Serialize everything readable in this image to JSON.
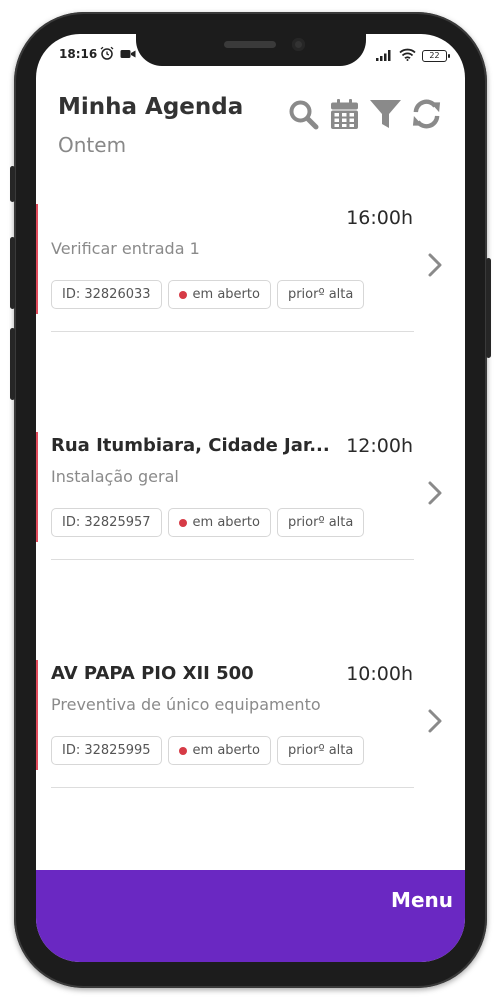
{
  "status": {
    "time": "18:16",
    "battery": "22",
    "icons": [
      "alarm-icon",
      "video-icon",
      "signal-icon",
      "wifi-icon",
      "battery-icon"
    ]
  },
  "header": {
    "title": "Minha Agenda",
    "subtitle": "Ontem",
    "actions": [
      "search-icon",
      "calendar-icon",
      "filter-icon",
      "refresh-icon"
    ]
  },
  "tasks": [
    {
      "address": "",
      "time": "16:00h",
      "description": "Verificar entrada 1",
      "id": "ID: 32826033",
      "status": "em aberto",
      "priority": "priorº alta"
    },
    {
      "address": "Rua Itumbiara, Cidade Jar...",
      "time": "12:00h",
      "description": "Instalação geral",
      "id": "ID: 32825957",
      "status": "em aberto",
      "priority": "priorº alta"
    },
    {
      "address": "AV PAPA PIO XII 500",
      "time": "10:00h",
      "description": "Preventiva de único equipamento",
      "id": "ID: 32825995",
      "status": "em aberto",
      "priority": "priorº alta"
    }
  ],
  "footer": {
    "menu_label": "Menu"
  },
  "colors": {
    "accent": "#6a28c2",
    "status_open": "#d63b46",
    "task_bar": "#e04b5b"
  }
}
